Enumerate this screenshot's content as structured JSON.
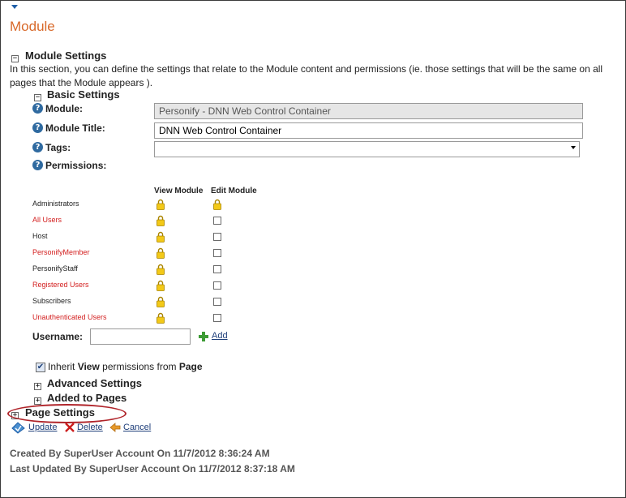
{
  "page": {
    "title": "Module"
  },
  "module_settings": {
    "title": "Module Settings",
    "description": "In this section, you can define the settings that relate to the Module content and permissions (ie. those settings that will be the same on all pages that the Module appears )."
  },
  "basic_settings": {
    "title": "Basic Settings",
    "module_label": "Module:",
    "module_value": "Personify - DNN Web Control Container",
    "module_title_label": "Module Title:",
    "module_title_value": "DNN Web Control Container",
    "tags_label": "Tags:",
    "tags_value": "",
    "permissions_label": "Permissions:"
  },
  "permissions": {
    "columns": [
      "View Module",
      "Edit Module"
    ],
    "roles": [
      {
        "name": "Administrators",
        "color": "#222222"
      },
      {
        "name": "All Users",
        "color": "#d32020"
      },
      {
        "name": "Host",
        "color": "#222222"
      },
      {
        "name": "PersonifyMember",
        "color": "#d32020"
      },
      {
        "name": "PersonifyStaff",
        "color": "#222222"
      },
      {
        "name": "Registered Users",
        "color": "#d32020"
      },
      {
        "name": "Subscribers",
        "color": "#222222"
      },
      {
        "name": "Unauthenticated Users",
        "color": "#d32020"
      }
    ],
    "username_label": "Username:",
    "username_value": "",
    "add_label": "Add",
    "inherit_prefix": "Inherit ",
    "inherit_view": "View",
    "inherit_mid": " permissions from ",
    "inherit_page": "Page",
    "inherit_checked": true
  },
  "collapsed_sections": {
    "advanced": "Advanced Settings",
    "added_to_pages": "Added to Pages",
    "page_settings": "Page Settings"
  },
  "actions": {
    "update": "Update",
    "delete": "Delete",
    "cancel": "Cancel"
  },
  "footer": {
    "created": "Created By SuperUser Account On 11/7/2012 8:36:24 AM",
    "updated": "Last Updated By SuperUser Account On 11/7/2012 8:37:18 AM"
  },
  "colors": {
    "title_orange": "#d8692a",
    "role_red": "#d32020",
    "highlight_ellipse": "#b0242a",
    "link_blue": "#1f3f7a"
  }
}
